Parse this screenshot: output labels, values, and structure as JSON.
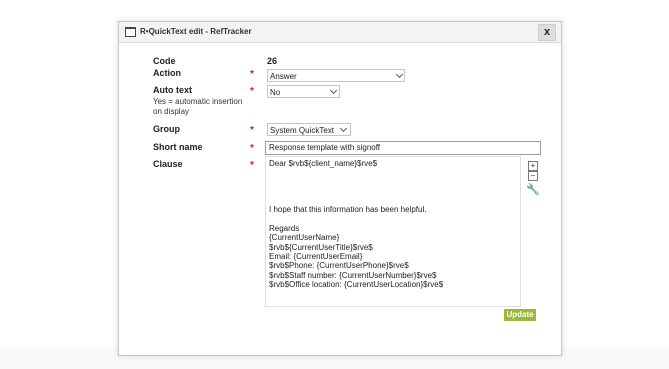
{
  "window": {
    "title": "R•QuickText edit - RefTracker",
    "close_label": "x"
  },
  "form": {
    "code_label": "Code",
    "code_value": "26",
    "action_label": "Action",
    "action_value": "Answer",
    "autotext_label": "Auto text",
    "autotext_hint": "Yes = automatic insertion\non display",
    "autotext_value": "No",
    "group_label": "Group",
    "group_value": "System QuickText",
    "shortname_label": "Short name",
    "shortname_value": "Response template with signoff",
    "clause_label": "Clause",
    "clause_value": "Dear $rvb${client_name}$rve$\n\n\n\n\nI hope that this information has been helpful.\n\nRegards\n{CurrentUserName}\n$rvb${CurrentUserTitle}$rve$\nEmail: {CurrentUserEmail}\n$rvb$Phone: {CurrentUserPhone}$rve$\n$rvb$Staff number: {CurrentUserNumber}$rve$\n$rvb$Office location: {CurrentUserLocation}$rve$",
    "required_marker": "*",
    "expand_label": "+",
    "collapse_label": "−",
    "update_label": "Update"
  },
  "colors": {
    "required": "#d0261d",
    "update_button": "#9ab93b"
  }
}
